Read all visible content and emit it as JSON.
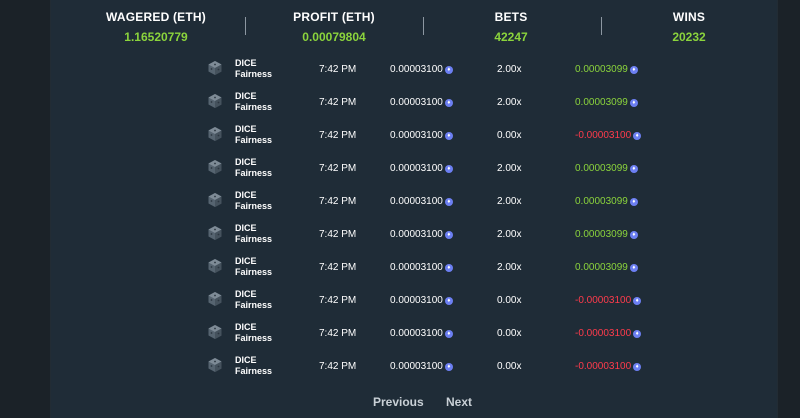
{
  "stats": [
    {
      "label": "WAGERED (ETH)",
      "value": "1.16520779"
    },
    {
      "label": "PROFIT (ETH)",
      "value": "0.00079804"
    },
    {
      "label": "BETS",
      "value": "42247"
    },
    {
      "label": "WINS",
      "value": "20232"
    }
  ],
  "bets": [
    {
      "game": "DICE",
      "link": "Fairness",
      "time": "7:42 PM",
      "amount": "0.00003100",
      "multiplier": "2.00x",
      "profit": "0.00003099",
      "result": "win"
    },
    {
      "game": "DICE",
      "link": "Fairness",
      "time": "7:42 PM",
      "amount": "0.00003100",
      "multiplier": "2.00x",
      "profit": "0.00003099",
      "result": "win"
    },
    {
      "game": "DICE",
      "link": "Fairness",
      "time": "7:42 PM",
      "amount": "0.00003100",
      "multiplier": "0.00x",
      "profit": "-0.00003100",
      "result": "loss"
    },
    {
      "game": "DICE",
      "link": "Fairness",
      "time": "7:42 PM",
      "amount": "0.00003100",
      "multiplier": "2.00x",
      "profit": "0.00003099",
      "result": "win"
    },
    {
      "game": "DICE",
      "link": "Fairness",
      "time": "7:42 PM",
      "amount": "0.00003100",
      "multiplier": "2.00x",
      "profit": "0.00003099",
      "result": "win"
    },
    {
      "game": "DICE",
      "link": "Fairness",
      "time": "7:42 PM",
      "amount": "0.00003100",
      "multiplier": "2.00x",
      "profit": "0.00003099",
      "result": "win"
    },
    {
      "game": "DICE",
      "link": "Fairness",
      "time": "7:42 PM",
      "amount": "0.00003100",
      "multiplier": "2.00x",
      "profit": "0.00003099",
      "result": "win"
    },
    {
      "game": "DICE",
      "link": "Fairness",
      "time": "7:42 PM",
      "amount": "0.00003100",
      "multiplier": "0.00x",
      "profit": "-0.00003100",
      "result": "loss"
    },
    {
      "game": "DICE",
      "link": "Fairness",
      "time": "7:42 PM",
      "amount": "0.00003100",
      "multiplier": "0.00x",
      "profit": "-0.00003100",
      "result": "loss"
    },
    {
      "game": "DICE",
      "link": "Fairness",
      "time": "7:42 PM",
      "amount": "0.00003100",
      "multiplier": "0.00x",
      "profit": "-0.00003100",
      "result": "loss"
    }
  ],
  "icons": {
    "game": "dice-icon",
    "currency": "eth-icon"
  },
  "colors": {
    "positive": "#8bd43c",
    "negative": "#ff3b4c",
    "panel": "#1f2c37"
  },
  "pagination": {
    "previous": "Previous",
    "next": "Next"
  }
}
